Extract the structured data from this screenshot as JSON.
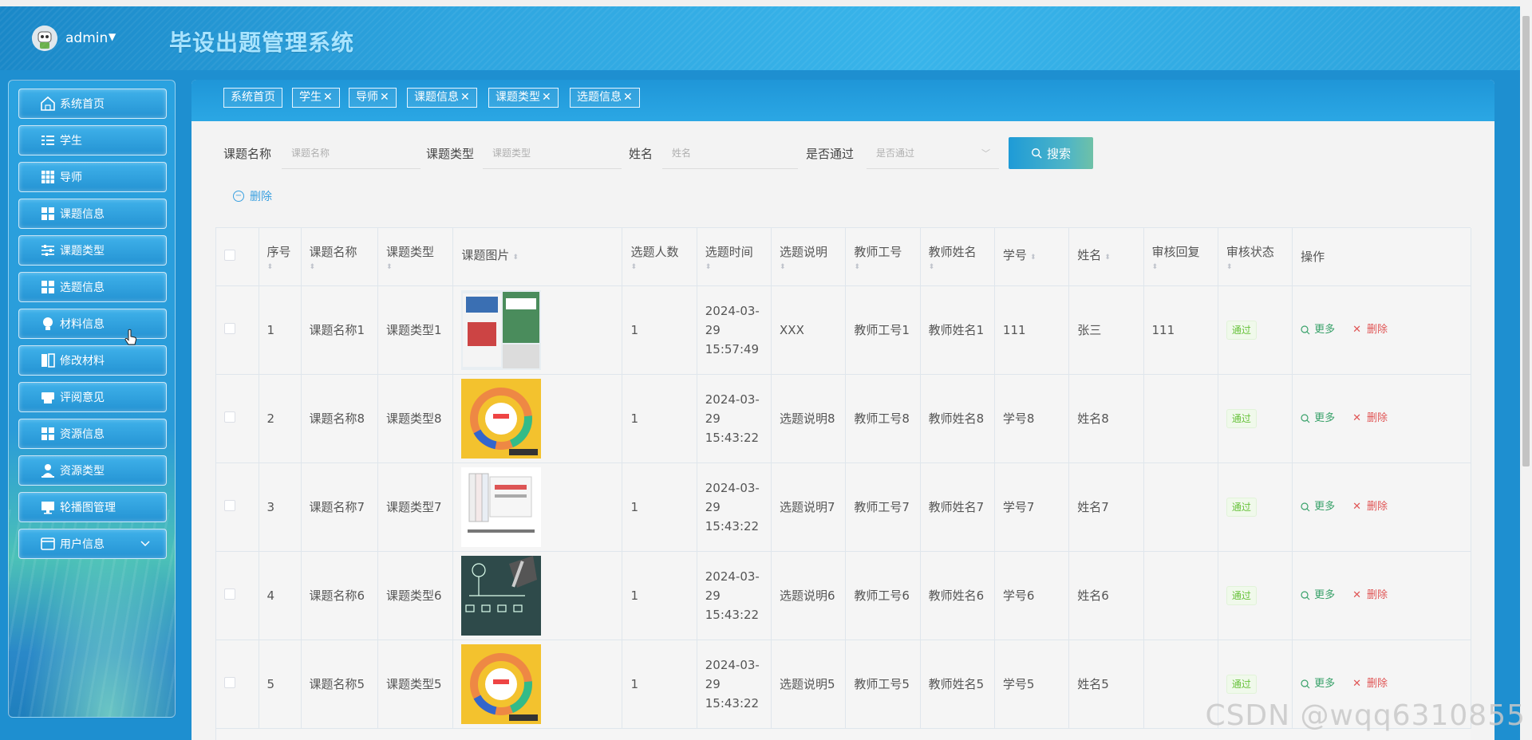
{
  "header": {
    "user": "admin",
    "app_title": "毕设出题管理系统"
  },
  "sidebar": {
    "items": [
      {
        "label": "系统首页",
        "icon": "home-icon"
      },
      {
        "label": "学生",
        "icon": "list-icon"
      },
      {
        "label": "导师",
        "icon": "grid-icon"
      },
      {
        "label": "课题信息",
        "icon": "apps-icon"
      },
      {
        "label": "课题类型",
        "icon": "sliders-icon"
      },
      {
        "label": "选题信息",
        "icon": "apps-icon"
      },
      {
        "label": "材料信息",
        "icon": "bulb-icon"
      },
      {
        "label": "修改材料",
        "icon": "book-icon"
      },
      {
        "label": "评阅意见",
        "icon": "printer-icon"
      },
      {
        "label": "资源信息",
        "icon": "apps-icon"
      },
      {
        "label": "资源类型",
        "icon": "user-icon"
      },
      {
        "label": "轮播图管理",
        "icon": "monitor-icon"
      },
      {
        "label": "用户信息",
        "icon": "card-icon",
        "expandable": true
      }
    ]
  },
  "tabs": [
    {
      "label": "系统首页",
      "closable": false
    },
    {
      "label": "学生",
      "closable": true
    },
    {
      "label": "导师",
      "closable": true
    },
    {
      "label": "课题信息",
      "closable": true
    },
    {
      "label": "课题类型",
      "closable": true
    },
    {
      "label": "选题信息",
      "closable": true
    }
  ],
  "close_glyph": "✕",
  "search": {
    "fields": [
      {
        "label": "课题名称",
        "placeholder": "课题名称"
      },
      {
        "label": "课题类型",
        "placeholder": "课题类型"
      },
      {
        "label": "姓名",
        "placeholder": "姓名"
      },
      {
        "label": "是否通过",
        "placeholder": "是否通过"
      }
    ],
    "button": "搜索",
    "delete_button": "删除"
  },
  "table": {
    "headers": [
      "序号",
      "课题名称",
      "课题类型",
      "课题图片",
      "选题人数",
      "选题时间",
      "选题说明",
      "教师工号",
      "教师姓名",
      "学号",
      "姓名",
      "审核回复",
      "审核状态",
      "操作"
    ],
    "rows": [
      {
        "index": "1",
        "name": "课题名称1",
        "type": "课题类型1",
        "image": "book-cover-blue",
        "count": "1",
        "time": "2024-03-29 15:57:49",
        "desc": "XXX",
        "teacher_no": "教师工号1",
        "teacher_name": "教师姓名1",
        "student_no": "111",
        "student_name": "张三",
        "reply": "111",
        "status": "通过"
      },
      {
        "index": "2",
        "name": "课题名称8",
        "type": "课题类型8",
        "image": "book-cover-yellow",
        "count": "1",
        "time": "2024-03-29 15:43:22",
        "desc": "选题说明8",
        "teacher_no": "教师工号8",
        "teacher_name": "教师姓名8",
        "student_no": "学号8",
        "student_name": "姓名8",
        "reply": "",
        "status": "通过"
      },
      {
        "index": "3",
        "name": "课题名称7",
        "type": "课题类型7",
        "image": "book-set-white",
        "count": "1",
        "time": "2024-03-29 15:43:22",
        "desc": "选题说明7",
        "teacher_no": "教师工号7",
        "teacher_name": "教师姓名7",
        "student_no": "学号7",
        "student_name": "姓名7",
        "reply": "",
        "status": "通过"
      },
      {
        "index": "4",
        "name": "课题名称6",
        "type": "课题类型6",
        "image": "chalkboard-diagram",
        "count": "1",
        "time": "2024-03-29 15:43:22",
        "desc": "选题说明6",
        "teacher_no": "教师工号6",
        "teacher_name": "教师姓名6",
        "student_no": "学号6",
        "student_name": "姓名6",
        "reply": "",
        "status": "通过"
      },
      {
        "index": "5",
        "name": "课题名称5",
        "type": "课题类型5",
        "image": "book-cover-yellow",
        "count": "1",
        "time": "2024-03-29 15:43:22",
        "desc": "选题说明5",
        "teacher_no": "教师工号5",
        "teacher_name": "教师姓名5",
        "student_no": "学号5",
        "student_name": "姓名5",
        "reply": "",
        "status": "通过"
      }
    ],
    "action_more": "更多",
    "action_delete": "删除",
    "action_delete_glyph": "✕",
    "sort_glyph": "⬍"
  },
  "watermark": "CSDN @wqq6310855",
  "colors": {
    "primary": "#2ba2dc",
    "status_ok": "#67c23a",
    "danger": "#e05555",
    "more": "#38a169"
  }
}
